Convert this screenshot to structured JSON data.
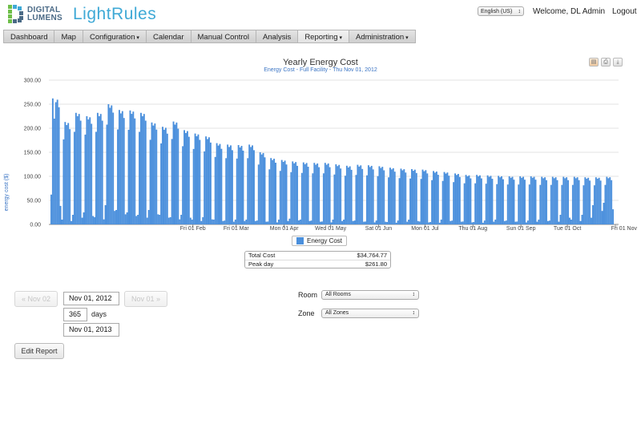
{
  "header": {
    "logo_line1": "DIGITAL",
    "logo_line2": "LUMENS",
    "product_name": "LightRules",
    "language": "English (US)",
    "welcome": "Welcome, DL Admin",
    "logout": "Logout"
  },
  "nav": {
    "items": [
      {
        "label": "Dashboard",
        "dropdown": false
      },
      {
        "label": "Map",
        "dropdown": false
      },
      {
        "label": "Configuration",
        "dropdown": true
      },
      {
        "label": "Calendar",
        "dropdown": false
      },
      {
        "label": "Manual Control",
        "dropdown": false
      },
      {
        "label": "Analysis",
        "dropdown": false
      },
      {
        "label": "Reporting",
        "dropdown": true
      },
      {
        "label": "Administration",
        "dropdown": true
      }
    ],
    "active": "Reporting"
  },
  "chart_header": {
    "title": "Yearly Energy Cost",
    "subtitle": "Energy Cost - Full Facility - Thu Nov 01, 2012"
  },
  "export_icons": [
    "html-export-icon",
    "print-icon",
    "download-icon"
  ],
  "chart_data": {
    "type": "bar",
    "ylabel": "energy cost ($)",
    "ylim": [
      0,
      300
    ],
    "yticks": [
      "0.00",
      "50.00",
      "100.00",
      "150.00",
      "200.00",
      "250.00",
      "300.00"
    ],
    "xtick_labels": [
      "Fri 01 Feb",
      "Fri 01 Mar",
      "Mon 01 Apr",
      "Wed 01 May",
      "Sat 01 Jun",
      "Mon 01 Jul",
      "Thu 01 Aug",
      "Sun 01 Sep",
      "Tue 01 Oct",
      "Fri 01 Nov"
    ],
    "grid": true,
    "legend_position": "bottom-center",
    "series": [
      {
        "name": "Energy Cost",
        "color": "#4a8fdc",
        "week_highs": [
          262,
          213,
          232,
          225,
          232,
          250,
          238,
          237,
          232,
          212,
          203,
          214,
          196,
          189,
          183,
          169,
          166,
          165,
          166,
          150,
          138,
          134,
          131,
          129,
          128,
          128,
          125,
          122,
          124,
          123,
          121,
          118,
          116,
          115,
          114,
          111,
          109,
          106,
          103,
          103,
          102,
          101,
          100,
          100,
          100,
          99,
          99,
          99,
          99,
          98,
          98,
          99
        ],
        "week_lows": [
          55,
          10,
          20,
          25,
          15,
          40,
          30,
          25,
          20,
          30,
          20,
          15,
          20,
          10,
          15,
          10,
          8,
          10,
          10,
          8,
          6,
          10,
          12,
          10,
          8,
          6,
          10,
          10,
          8,
          6,
          8,
          5,
          8,
          10,
          6,
          5,
          10,
          8,
          6,
          5,
          8,
          10,
          8,
          6,
          8,
          10,
          8,
          20,
          10,
          20,
          40,
          45
        ]
      }
    ]
  },
  "summary": {
    "rows": [
      {
        "label": "Total Cost",
        "value": "$34,764.77"
      },
      {
        "label": "Peak day",
        "value": "$261.80"
      }
    ]
  },
  "controls": {
    "prev_button": "« Nov 02",
    "next_button": "Nov 01 »",
    "start_date": "Nov 01, 2012",
    "days_value": "365",
    "days_label": "days",
    "end_date": "Nov 01, 2013",
    "edit_report": "Edit Report",
    "room_label": "Room",
    "room_value": "All Rooms",
    "zone_label": "Zone",
    "zone_value": "All Zones"
  }
}
